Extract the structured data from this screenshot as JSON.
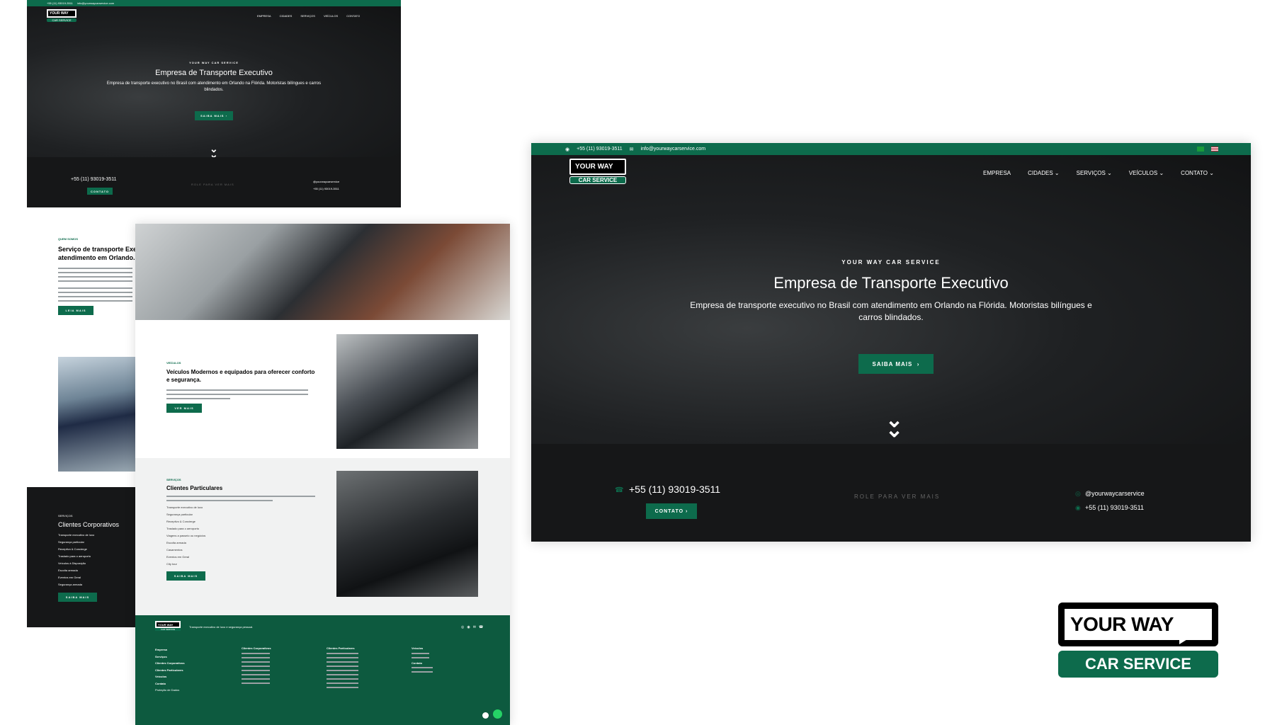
{
  "topbar": {
    "phone": "+55 (11) 93019-3511",
    "email": "info@yourwaycarservice.com"
  },
  "logo": {
    "line1": "YOUR WAY",
    "line2": "CAR SERVICE"
  },
  "nav": [
    "EMPRESA",
    "CIDADES",
    "SERVIÇOS",
    "VEÍCULOS",
    "CONTATO"
  ],
  "hero": {
    "eyebrow": "YOUR WAY CAR SERVICE",
    "title": "Empresa de Transporte Executivo",
    "subtitle": "Empresa de transporte executivo no Brasil com atendimento em Orlando na Flórida. Motoristas bilíngues e carros blindados.",
    "cta": "SAIBA MAIS"
  },
  "contact_strip": {
    "phone": "+55 (11) 93019-3511",
    "contact_btn": "CONTATO",
    "scroll": "ROLE PARA VER MAIS",
    "instagram": "@yourwaycarservice",
    "whatsapp": "+55 (11) 93019-3511"
  },
  "about": {
    "eyebrow": "QUEM SOMOS",
    "title": "Serviço de transporte Exe atendimento em Orlando.",
    "btn": "LEIA MAIS"
  },
  "vehicles": {
    "eyebrow": "VEÍCULOS",
    "title": "Veículos Modernos e equipados para oferecer conforto e segurança.",
    "btn": "VER MAIS"
  },
  "particulares": {
    "eyebrow": "SERVIÇOS",
    "title": "Clientes Particulares",
    "items": [
      "Transporte executivo de luxo",
      "Segurança particular",
      "Receptivo & Concierge",
      "Traslado para o aeroporto",
      "Viagens a passeio ou negócios",
      "Escolta armada",
      "Casamentos",
      "Eventos em Geral",
      "City tour"
    ],
    "btn": "SAIBA MAIS"
  },
  "corporativos": {
    "eyebrow": "SERVIÇOS",
    "title": "Clientes Corporativos",
    "items": [
      "Transporte executivo de luxo",
      "Segurança particular",
      "Receptivo & Concierge",
      "Traslado para o aeroporto",
      "Veículos à Disposição",
      "Escolta armada",
      "Eventos em Geral",
      "Segurança armada"
    ],
    "btn": "SAIBA MAIS"
  },
  "footer": {
    "tagline": "Transporte executivo de luxo e segurança pessoal.",
    "col1": [
      "Empresa",
      "Serviços",
      "Clientes Corporativos",
      "Clientes Particulares",
      "Veículos",
      "Contato",
      "Proteção de Dados"
    ],
    "col2_title": "Clientes Corporativos",
    "col3_title": "Clientes Particulares",
    "col4_title": "Veículos",
    "col4_sub": "Contato"
  },
  "colors": {
    "brand": "#0d6b4c",
    "dark": "#161718"
  }
}
